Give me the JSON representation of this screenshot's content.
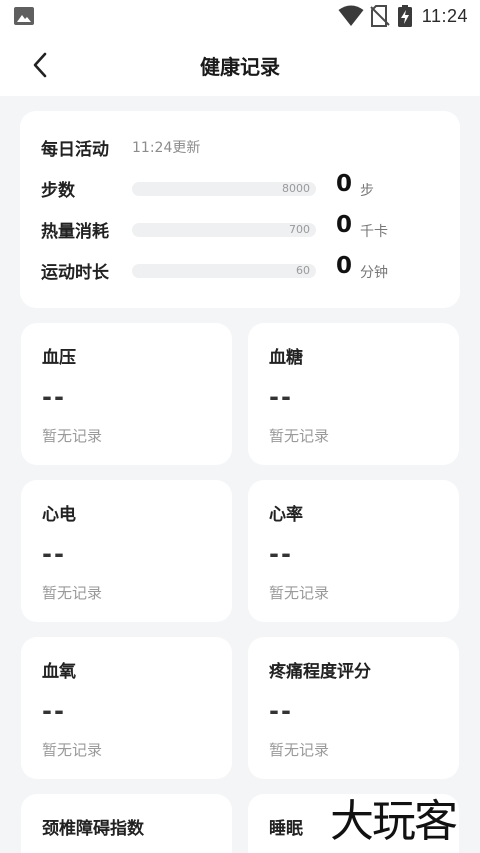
{
  "status_bar": {
    "time": "11:24"
  },
  "header": {
    "title": "健康记录"
  },
  "activity": {
    "title": "每日活动",
    "updated": "11:24更新",
    "rows": [
      {
        "label": "步数",
        "goal": "8000",
        "value": "0",
        "unit": "步",
        "progress": 0
      },
      {
        "label": "热量消耗",
        "goal": "700",
        "value": "0",
        "unit": "千卡",
        "progress": 0
      },
      {
        "label": "运动时长",
        "goal": "60",
        "value": "0",
        "unit": "分钟",
        "progress": 0
      }
    ]
  },
  "metrics": [
    {
      "title": "血压",
      "value": "--",
      "status": "暂无记录"
    },
    {
      "title": "血糖",
      "value": "--",
      "status": "暂无记录"
    },
    {
      "title": "心电",
      "value": "--",
      "status": "暂无记录"
    },
    {
      "title": "心率",
      "value": "--",
      "status": "暂无记录"
    },
    {
      "title": "血氧",
      "value": "--",
      "status": "暂无记录"
    },
    {
      "title": "疼痛程度评分",
      "value": "--",
      "status": "暂无记录"
    },
    {
      "title": "颈椎障碍指数",
      "value": "",
      "status": ""
    },
    {
      "title": "睡眠",
      "value": "",
      "status": ""
    }
  ],
  "watermark": "大玩客"
}
